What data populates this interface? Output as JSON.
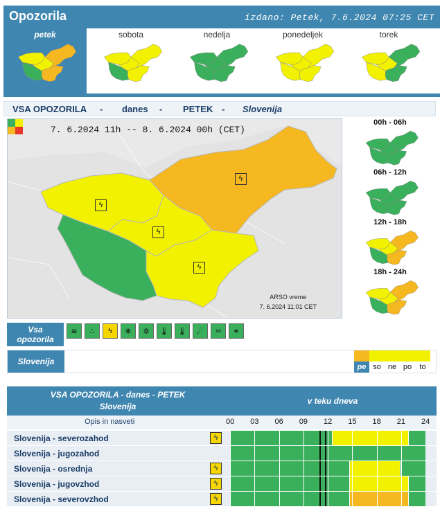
{
  "header": {
    "title": "Opozorila",
    "issued": "izdano: Petek, 7.6.2024 07:25 CET"
  },
  "days": [
    {
      "label": "petek",
      "active": true,
      "regions": [
        "#3aaf5c",
        "#f2f200",
        "#f2f200",
        "#f6b820",
        "#f6b820"
      ]
    },
    {
      "label": "sobota",
      "active": false,
      "regions": [
        "#3aaf5c",
        "#f2f200",
        "#f2f200",
        "#f2f200",
        "#f2f200"
      ]
    },
    {
      "label": "nedelja",
      "active": false,
      "regions": [
        "#3aaf5c",
        "#3aaf5c",
        "#3aaf5c",
        "#3aaf5c",
        "#3aaf5c"
      ]
    },
    {
      "label": "ponedeljek",
      "active": false,
      "regions": [
        "#f2f200",
        "#f2f200",
        "#f2f200",
        "#f2f200",
        "#f2f200"
      ]
    },
    {
      "label": "torek",
      "active": false,
      "regions": [
        "#f2f200",
        "#f2f200",
        "#f2f200",
        "#3aaf5c",
        "#3aaf5c"
      ]
    }
  ],
  "summary": {
    "left": "VSA OPOZORILA",
    "sep": "-",
    "when": "danes",
    "day": "PETEK",
    "region": "Slovenija"
  },
  "map": {
    "when": "7. 6.2024 11h -- 8. 6.2024 00h (CET)",
    "credit_line1": "ARSO vreme",
    "credit_line2": "7. 6.2024 11:01 CET",
    "regions": {
      "jugozahod": "#3aaf5c",
      "severozahod": "#f2f200",
      "osrednja": "#f2f200",
      "jugovzhod": "#f2f200",
      "severovzhod": "#f6b820"
    }
  },
  "periods": [
    {
      "label": "00h - 06h",
      "regions": [
        "#3aaf5c",
        "#3aaf5c",
        "#3aaf5c",
        "#3aaf5c",
        "#3aaf5c"
      ]
    },
    {
      "label": "06h - 12h",
      "regions": [
        "#3aaf5c",
        "#3aaf5c",
        "#3aaf5c",
        "#3aaf5c",
        "#3aaf5c"
      ]
    },
    {
      "label": "12h - 18h",
      "regions": [
        "#3aaf5c",
        "#f2f200",
        "#f2f200",
        "#f6b820",
        "#f6b820"
      ]
    },
    {
      "label": "18h - 24h",
      "regions": [
        "#3aaf5c",
        "#f2f200",
        "#f2f200",
        "#f6b820",
        "#f6b820"
      ]
    }
  ],
  "icon_row": {
    "label_line1": "Vsa",
    "label_line2": "opozorila",
    "icons": [
      {
        "name": "wind-icon",
        "glyph": "≋",
        "on": false
      },
      {
        "name": "rain-icon",
        "glyph": "∴",
        "on": false
      },
      {
        "name": "thunderstorm-icon",
        "glyph": "ϟ",
        "on": true
      },
      {
        "name": "snow-icon",
        "glyph": "❄",
        "on": false
      },
      {
        "name": "snow-rain-icon",
        "glyph": "✲",
        "on": false
      },
      {
        "name": "heat-icon",
        "glyph": "🌡",
        "on": false
      },
      {
        "name": "cold-icon",
        "glyph": "🌡",
        "on": false
      },
      {
        "name": "fire-icon",
        "glyph": "☄",
        "on": false
      },
      {
        "name": "fog-icon",
        "glyph": "∞",
        "on": false
      },
      {
        "name": "ice-icon",
        "glyph": "⚭",
        "on": false
      }
    ]
  },
  "slovenija_row": {
    "label": "Slovenija",
    "levels": [
      {
        "text": "pe",
        "color": "#f6b820",
        "selected": true
      },
      {
        "text": "so",
        "color": "#f2f200",
        "selected": false
      },
      {
        "text": "ne",
        "color": "#f2f200",
        "selected": false
      },
      {
        "text": "po",
        "color": "#f2f200",
        "selected": false
      },
      {
        "text": "to",
        "color": "#f2f200",
        "selected": false
      }
    ]
  },
  "table": {
    "title_line1": "VSA OPOZORILA - danes - PETEK",
    "title_line2": "Slovenija",
    "timeline_label": "v teku dneva",
    "opis": "Opis in nasveti",
    "hours": [
      "00",
      "03",
      "06",
      "09",
      "12",
      "15",
      "18",
      "21",
      "24"
    ],
    "rows": [
      {
        "name": "Slovenija - severozahod",
        "icon": true,
        "slots": [
          "#3aaf5c",
          "#3aaf5c",
          "#3aaf5c",
          "#3aaf5c",
          "#3aaf5c",
          "#3aaf5c",
          "#3aaf5c",
          "#3aaf5c",
          "#3aaf5c",
          "#3aaf5c",
          "#3aaf5c",
          "#3aaf5c",
          "#3aaf5c",
          "#3aaf5c",
          "#3aaf5c",
          "#3aaf5c",
          "#3aaf5c",
          "#3aaf5c",
          "#3aaf5c",
          "#3aaf5c",
          "#3aaf5c",
          "#3aaf5c",
          "#3aaf5c",
          "#3aaf5c",
          "#3aaf5c",
          "#3aaf5c",
          "#3aaf5c",
          "#3aaf5c",
          "#3aaf5c",
          "#3aaf5c",
          "#3aaf5c",
          "#3aaf5c",
          "#3aaf5c",
          "#3aaf5c",
          "#3aaf5c",
          "#3aaf5c",
          "#3aaf5c",
          "#3aaf5c",
          "#3aaf5c",
          "#3aaf5c",
          "#3aaf5c",
          "#3aaf5c",
          "#3aaf5c",
          "#3aaf5c",
          "#3aaf5c",
          "#3aaf5c",
          "#3aaf5c",
          "#3aaf5c",
          "#f2f200",
          "#f2f200",
          "#f2f200",
          "#f2f200",
          "#f2f200",
          "#f2f200",
          "#f2f200",
          "#f2f200",
          "#f2f200",
          "#f2f200",
          "#f2f200",
          "#f2f200",
          "#f2f200",
          "#f2f200",
          "#f2f200",
          "#f2f200",
          "#f2f200",
          "#f2f200",
          "#f2f200",
          "#f2f200",
          "#f2f200",
          "#f2f200",
          "#f2f200",
          "#f2f200",
          "#f2f200",
          "#f2f200",
          "#f2f200",
          "#f2f200",
          "#f2f200",
          "#f2f200",
          "#f2f200",
          "#f2f200",
          "#f2f200",
          "#f2f200",
          "#f2f200",
          "#f2f200",
          "#3aaf5c",
          "#3aaf5c",
          "#3aaf5c",
          "#3aaf5c",
          "#3aaf5c",
          "#3aaf5c",
          "#3aaf5c",
          "#3aaf5c"
        ]
      },
      {
        "name": "Slovenija - jugozahod",
        "icon": false,
        "slots": []
      },
      {
        "name": "Slovenija - osrednja",
        "icon": true,
        "slots": [
          "#3aaf5c",
          "#3aaf5c",
          "#3aaf5c",
          "#3aaf5c",
          "#3aaf5c",
          "#3aaf5c",
          "#3aaf5c",
          "#3aaf5c",
          "#3aaf5c",
          "#3aaf5c",
          "#3aaf5c",
          "#3aaf5c",
          "#3aaf5c",
          "#3aaf5c",
          "#3aaf5c",
          "#3aaf5c",
          "#3aaf5c",
          "#3aaf5c",
          "#3aaf5c",
          "#3aaf5c",
          "#3aaf5c",
          "#3aaf5c",
          "#3aaf5c",
          "#3aaf5c",
          "#3aaf5c",
          "#3aaf5c",
          "#3aaf5c",
          "#3aaf5c",
          "#3aaf5c",
          "#3aaf5c",
          "#3aaf5c",
          "#3aaf5c",
          "#3aaf5c",
          "#3aaf5c",
          "#3aaf5c",
          "#3aaf5c",
          "#3aaf5c",
          "#3aaf5c",
          "#3aaf5c",
          "#3aaf5c",
          "#3aaf5c",
          "#3aaf5c",
          "#3aaf5c",
          "#3aaf5c",
          "#3aaf5c",
          "#3aaf5c",
          "#3aaf5c",
          "#3aaf5c",
          "#3aaf5c",
          "#3aaf5c",
          "#3aaf5c",
          "#3aaf5c",
          "#3aaf5c",
          "#3aaf5c",
          "#3aaf5c",
          "#3aaf5c",
          "#f2f200",
          "#f2f200",
          "#f2f200",
          "#f2f200",
          "#f2f200",
          "#f2f200",
          "#f2f200",
          "#f2f200",
          "#f2f200",
          "#f2f200",
          "#f2f200",
          "#f2f200",
          "#f2f200",
          "#f2f200",
          "#f2f200",
          "#f2f200",
          "#f2f200",
          "#f2f200",
          "#f2f200",
          "#f2f200",
          "#f2f200",
          "#f2f200",
          "#f2f200",
          "#f2f200",
          "#3aaf5c",
          "#3aaf5c",
          "#3aaf5c",
          "#3aaf5c",
          "#3aaf5c",
          "#3aaf5c",
          "#3aaf5c",
          "#3aaf5c",
          "#3aaf5c",
          "#3aaf5c",
          "#3aaf5c",
          "#3aaf5c"
        ]
      },
      {
        "name": "Slovenija - jugovzhod",
        "icon": true,
        "slots": [
          "#3aaf5c",
          "#3aaf5c",
          "#3aaf5c",
          "#3aaf5c",
          "#3aaf5c",
          "#3aaf5c",
          "#3aaf5c",
          "#3aaf5c",
          "#3aaf5c",
          "#3aaf5c",
          "#3aaf5c",
          "#3aaf5c",
          "#3aaf5c",
          "#3aaf5c",
          "#3aaf5c",
          "#3aaf5c",
          "#3aaf5c",
          "#3aaf5c",
          "#3aaf5c",
          "#3aaf5c",
          "#3aaf5c",
          "#3aaf5c",
          "#3aaf5c",
          "#3aaf5c",
          "#3aaf5c",
          "#3aaf5c",
          "#3aaf5c",
          "#3aaf5c",
          "#3aaf5c",
          "#3aaf5c",
          "#3aaf5c",
          "#3aaf5c",
          "#3aaf5c",
          "#3aaf5c",
          "#3aaf5c",
          "#3aaf5c",
          "#3aaf5c",
          "#3aaf5c",
          "#3aaf5c",
          "#3aaf5c",
          "#3aaf5c",
          "#3aaf5c",
          "#3aaf5c",
          "#3aaf5c",
          "#3aaf5c",
          "#3aaf5c",
          "#3aaf5c",
          "#3aaf5c",
          "#3aaf5c",
          "#3aaf5c",
          "#3aaf5c",
          "#3aaf5c",
          "#3aaf5c",
          "#3aaf5c",
          "#3aaf5c",
          "#3aaf5c",
          "#f2f200",
          "#f2f200",
          "#f2f200",
          "#f2f200",
          "#f2f200",
          "#f2f200",
          "#f2f200",
          "#f2f200",
          "#f2f200",
          "#f2f200",
          "#f2f200",
          "#f2f200",
          "#f2f200",
          "#f2f200",
          "#f2f200",
          "#f2f200",
          "#f2f200",
          "#f2f200",
          "#f2f200",
          "#f2f200",
          "#f2f200",
          "#f2f200",
          "#f2f200",
          "#f2f200",
          "#f2f200",
          "#f2f200",
          "#f2f200",
          "#f2f200",
          "#3aaf5c",
          "#3aaf5c",
          "#3aaf5c",
          "#3aaf5c",
          "#3aaf5c",
          "#3aaf5c",
          "#3aaf5c",
          "#3aaf5c"
        ]
      },
      {
        "name": "Slovenija - severovzhod",
        "icon": true,
        "slots": [
          "#3aaf5c",
          "#3aaf5c",
          "#3aaf5c",
          "#3aaf5c",
          "#3aaf5c",
          "#3aaf5c",
          "#3aaf5c",
          "#3aaf5c",
          "#3aaf5c",
          "#3aaf5c",
          "#3aaf5c",
          "#3aaf5c",
          "#3aaf5c",
          "#3aaf5c",
          "#3aaf5c",
          "#3aaf5c",
          "#3aaf5c",
          "#3aaf5c",
          "#3aaf5c",
          "#3aaf5c",
          "#3aaf5c",
          "#3aaf5c",
          "#3aaf5c",
          "#3aaf5c",
          "#3aaf5c",
          "#3aaf5c",
          "#3aaf5c",
          "#3aaf5c",
          "#3aaf5c",
          "#3aaf5c",
          "#3aaf5c",
          "#3aaf5c",
          "#3aaf5c",
          "#3aaf5c",
          "#3aaf5c",
          "#3aaf5c",
          "#3aaf5c",
          "#3aaf5c",
          "#3aaf5c",
          "#3aaf5c",
          "#3aaf5c",
          "#3aaf5c",
          "#3aaf5c",
          "#3aaf5c",
          "#3aaf5c",
          "#3aaf5c",
          "#3aaf5c",
          "#3aaf5c",
          "#3aaf5c",
          "#3aaf5c",
          "#3aaf5c",
          "#3aaf5c",
          "#3aaf5c",
          "#3aaf5c",
          "#3aaf5c",
          "#3aaf5c",
          "#f6b820",
          "#f6b820",
          "#f6b820",
          "#f6b820",
          "#f6b820",
          "#f6b820",
          "#f6b820",
          "#f6b820",
          "#f6b820",
          "#f6b820",
          "#f6b820",
          "#f6b820",
          "#f6b820",
          "#f6b820",
          "#f6b820",
          "#f6b820",
          "#f6b820",
          "#f6b820",
          "#f6b820",
          "#f6b820",
          "#f6b820",
          "#f6b820",
          "#f6b820",
          "#f6b820",
          "#f6b820",
          "#f6b820",
          "#f6b820",
          "#f6b820",
          "#3aaf5c",
          "#3aaf5c",
          "#3aaf5c",
          "#3aaf5c",
          "#3aaf5c",
          "#3aaf5c",
          "#3aaf5c",
          "#3aaf5c"
        ]
      }
    ]
  }
}
